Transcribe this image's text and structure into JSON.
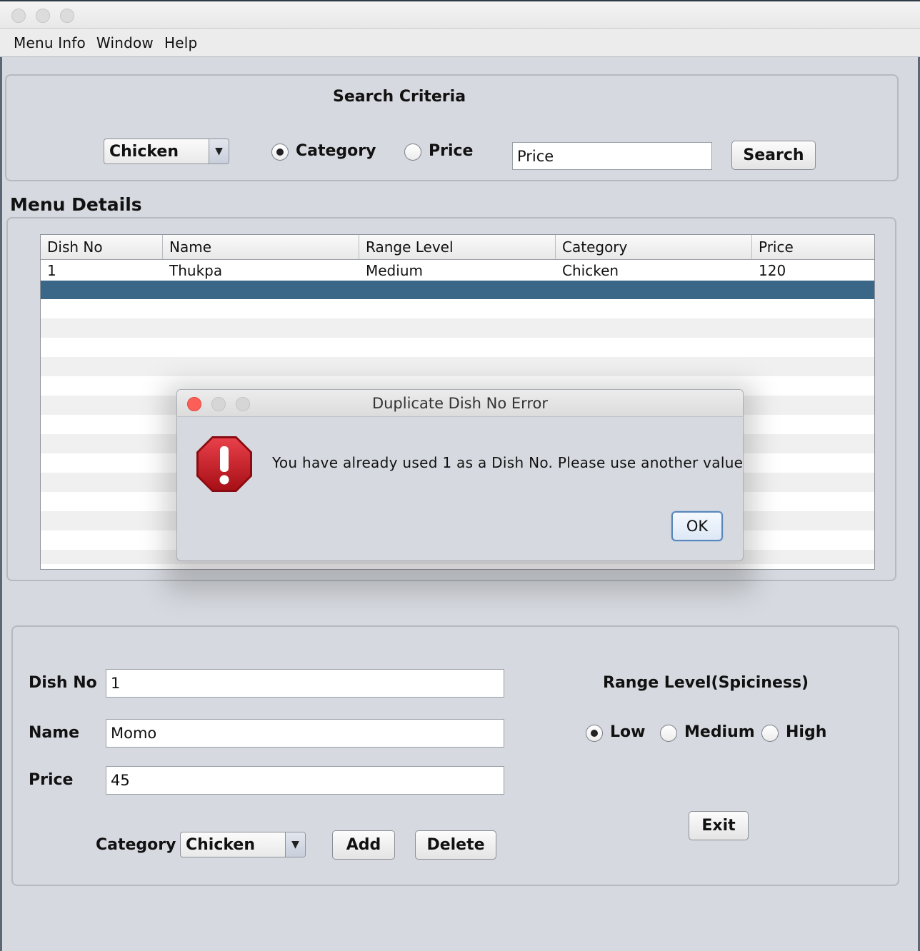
{
  "menubar": {
    "items": [
      "Menu Info",
      "Window",
      "Help"
    ]
  },
  "search": {
    "title": "Search Criteria",
    "combo_value": "Chicken",
    "radio_category": "Category",
    "radio_price": "Price",
    "selected_radio": "Category",
    "input_value": "Price",
    "button": "Search"
  },
  "details": {
    "title": "Menu Details",
    "columns": [
      "Dish No",
      "Name",
      "Range Level",
      "Category",
      "Price"
    ],
    "rows": [
      [
        "1",
        "Thukpa",
        "Medium",
        "Chicken",
        "120"
      ]
    ],
    "selection_color": "#3a6788"
  },
  "form": {
    "dish_no_label": "Dish No",
    "dish_no_value": "1",
    "name_label": "Name",
    "name_value": "Momo",
    "price_label": "Price",
    "price_value": "45",
    "category_label": "Category",
    "category_value": "Chicken",
    "add_button": "Add",
    "delete_button": "Delete",
    "range_title": "Range Level(Spiciness)",
    "range_options": [
      "Low",
      "Medium",
      "High"
    ],
    "range_selected": "Low",
    "exit_button": "Exit"
  },
  "dialog": {
    "title": "Duplicate Dish No Error",
    "message": "You have already used 1 as a Dish No. Please use another value",
    "icon": "error-stop-icon",
    "ok_button": "OK"
  },
  "colors": {
    "close_red": "#fc5f57",
    "error_red": "#c8171e"
  }
}
